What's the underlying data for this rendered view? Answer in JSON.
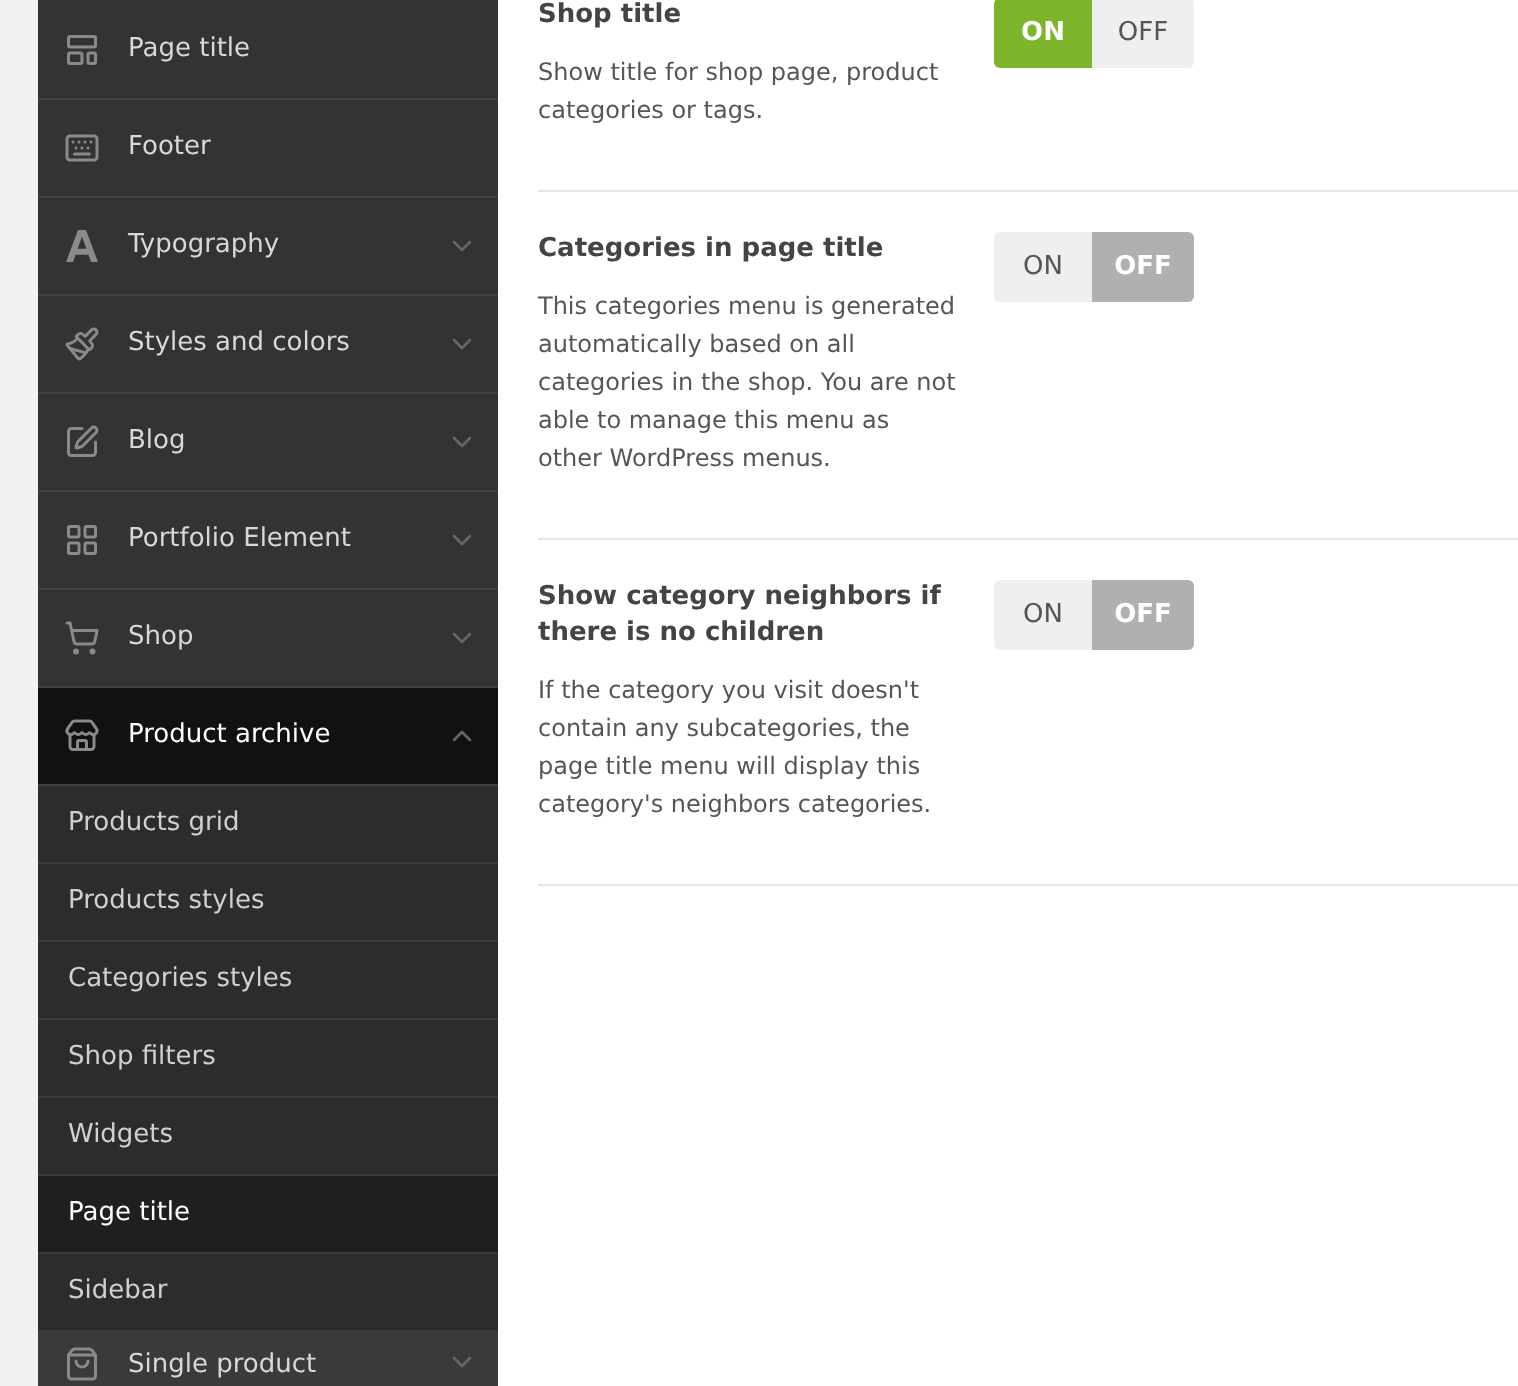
{
  "sidebar": {
    "items": [
      {
        "label": "Page title"
      },
      {
        "label": "Footer"
      },
      {
        "label": "Typography",
        "expanded": false
      },
      {
        "label": "Styles and colors",
        "expanded": false
      },
      {
        "label": "Blog",
        "expanded": false
      },
      {
        "label": "Portfolio Element",
        "expanded": false
      },
      {
        "label": "Shop",
        "expanded": false
      },
      {
        "label": "Product archive",
        "expanded": true,
        "children": [
          {
            "label": "Products grid",
            "selected": false
          },
          {
            "label": "Products styles",
            "selected": false
          },
          {
            "label": "Categories styles",
            "selected": false
          },
          {
            "label": "Shop filters",
            "selected": false
          },
          {
            "label": "Widgets",
            "selected": false
          },
          {
            "label": "Page title",
            "selected": true
          },
          {
            "label": "Sidebar",
            "selected": false
          }
        ]
      },
      {
        "label": "Single product",
        "expanded": false
      }
    ]
  },
  "settings": [
    {
      "title": "Shop title",
      "description": "Show title for shop page, product categories or tags.",
      "on": true,
      "on_label": "ON",
      "off_label": "OFF"
    },
    {
      "title": "Categories in page title",
      "description": "This categories menu is generated automatically based on all categories in the shop. You are not able to manage this menu as other WordPress menus.",
      "on": false,
      "on_label": "ON",
      "off_label": "OFF"
    },
    {
      "title": "Show category neighbors if there is no children",
      "description": "If the category you visit doesn't contain any subcategories, the page title menu will display this category's neighbors categories.",
      "on": false,
      "on_label": "ON",
      "off_label": "OFF"
    }
  ]
}
